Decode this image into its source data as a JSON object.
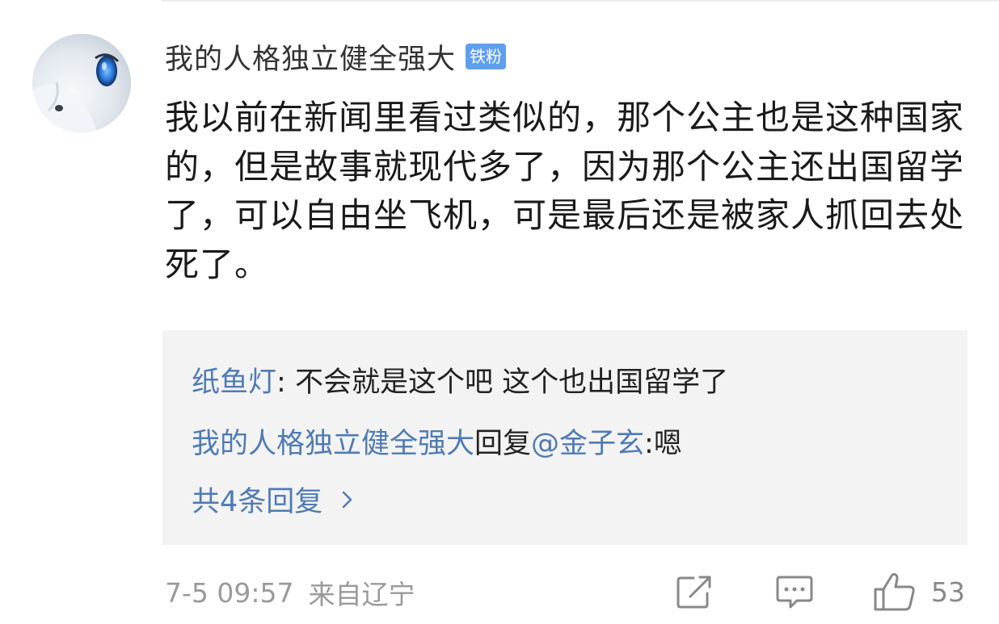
{
  "comment": {
    "username": "我的人格独立健全强大",
    "badge": "铁粉",
    "text": "我以前在新闻里看过类似的，那个公主也是这种国家的，但是故事就现代多了，因为那个公主还出国留学了，可以自由坐飞机，可是最后还是被家人抓回去处死了。"
  },
  "replies": [
    {
      "author": "纸鱼灯",
      "separator": ": ",
      "text": "不会就是这个吧 这个也出国留学了"
    },
    {
      "author": "我的人格独立健全强大",
      "reply_word": "回复",
      "mention": "@金子玄",
      "separator": ":",
      "text": "嗯"
    }
  ],
  "more_replies_label": "共4条回复",
  "footer": {
    "timestamp": "7-5 09:57",
    "location": "来自辽宁",
    "like_count": "53"
  },
  "icons": {
    "share": "share-icon",
    "comment": "comment-icon",
    "like": "thumbs-up-icon",
    "chevron": "chevron-right-icon"
  },
  "colors": {
    "link_blue": "#4f7bb5",
    "badge_blue": "#5f9ff0",
    "reply_bg": "#f3f3f3",
    "meta_gray": "#9a9a9a"
  }
}
